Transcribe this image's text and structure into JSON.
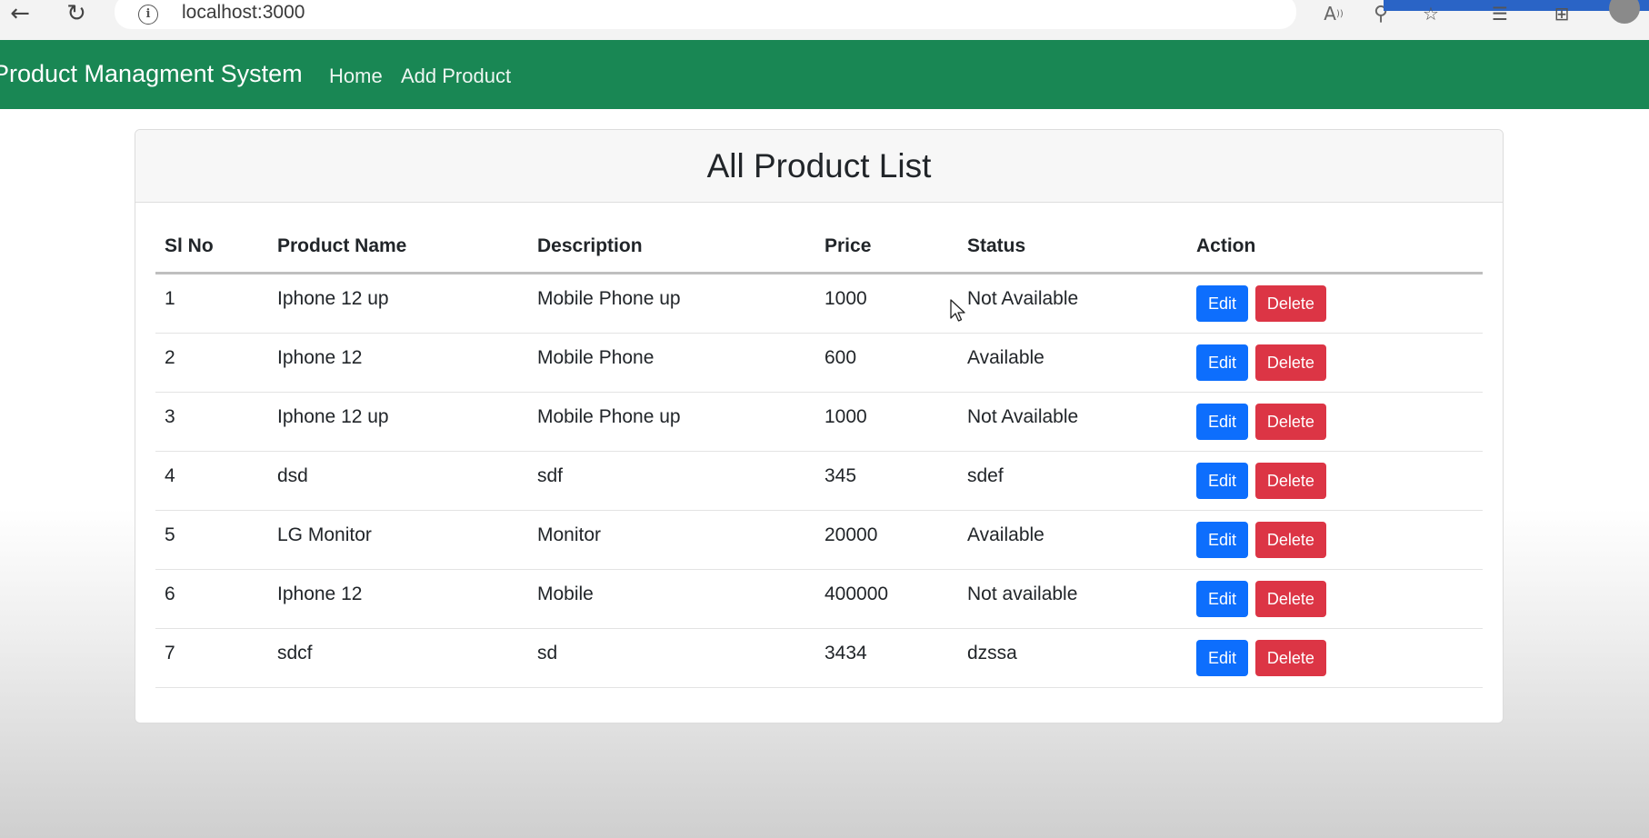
{
  "browser": {
    "url": "localhost:3000",
    "icons": [
      "back-icon",
      "reload-icon",
      "info-icon",
      "read-aloud-icon",
      "zoom-icon",
      "favorite-icon",
      "favorites-bar-icon",
      "collections-icon"
    ]
  },
  "navbar": {
    "brand": "Product Managment System",
    "links": [
      {
        "label": "Home"
      },
      {
        "label": "Add Product"
      }
    ],
    "color": "#198754"
  },
  "card": {
    "title": "All Product List"
  },
  "table": {
    "headers": [
      "Sl No",
      "Product Name",
      "Description",
      "Price",
      "Status",
      "Action"
    ],
    "rows": [
      {
        "sl": "1",
        "name": "Iphone 12 up",
        "description": "Mobile Phone up",
        "price": "1000",
        "status": "Not Available"
      },
      {
        "sl": "2",
        "name": "Iphone 12",
        "description": "Mobile Phone",
        "price": "600",
        "status": "Available"
      },
      {
        "sl": "3",
        "name": "Iphone 12 up",
        "description": "Mobile Phone up",
        "price": "1000",
        "status": "Not Available"
      },
      {
        "sl": "4",
        "name": "dsd",
        "description": "sdf",
        "price": "345",
        "status": "sdef"
      },
      {
        "sl": "5",
        "name": "LG Monitor",
        "description": "Monitor",
        "price": "20000",
        "status": "Available"
      },
      {
        "sl": "6",
        "name": "Iphone 12",
        "description": "Mobile",
        "price": "400000",
        "status": "Not available"
      },
      {
        "sl": "7",
        "name": "sdcf",
        "description": "sd",
        "price": "3434",
        "status": "dzssa"
      }
    ],
    "edit_label": "Edit",
    "delete_label": "Delete",
    "edit_color": "#0d6efd",
    "delete_color": "#dc3545"
  }
}
